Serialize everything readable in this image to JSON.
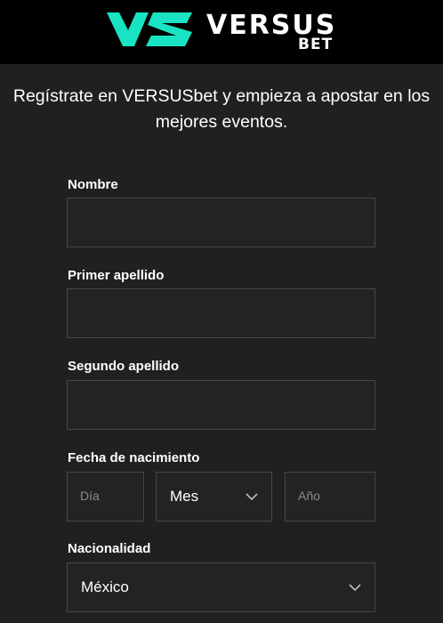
{
  "brand": {
    "word_main": "VERSUS",
    "word_sub": "BET",
    "mark_color": "#19e3c3",
    "mark_icon": "versus-logo-icon"
  },
  "intro_text": "Regístrate en VERSUSbet y empieza a apostar en los mejores eventos.",
  "form": {
    "nombre": {
      "label": "Nombre",
      "value": ""
    },
    "primer_apellido": {
      "label": "Primer apellido",
      "value": ""
    },
    "segundo_apellido": {
      "label": "Segundo apellido",
      "value": ""
    },
    "fecha": {
      "label": "Fecha de nacimiento",
      "dia_placeholder": "Día",
      "mes_selected": "Mes",
      "anio_placeholder": "Año"
    },
    "nacionalidad": {
      "label": "Nacionalidad",
      "selected": "México"
    }
  },
  "colors": {
    "header_bg": "#000000",
    "page_bg": "#202020",
    "field_border": "#474747"
  }
}
